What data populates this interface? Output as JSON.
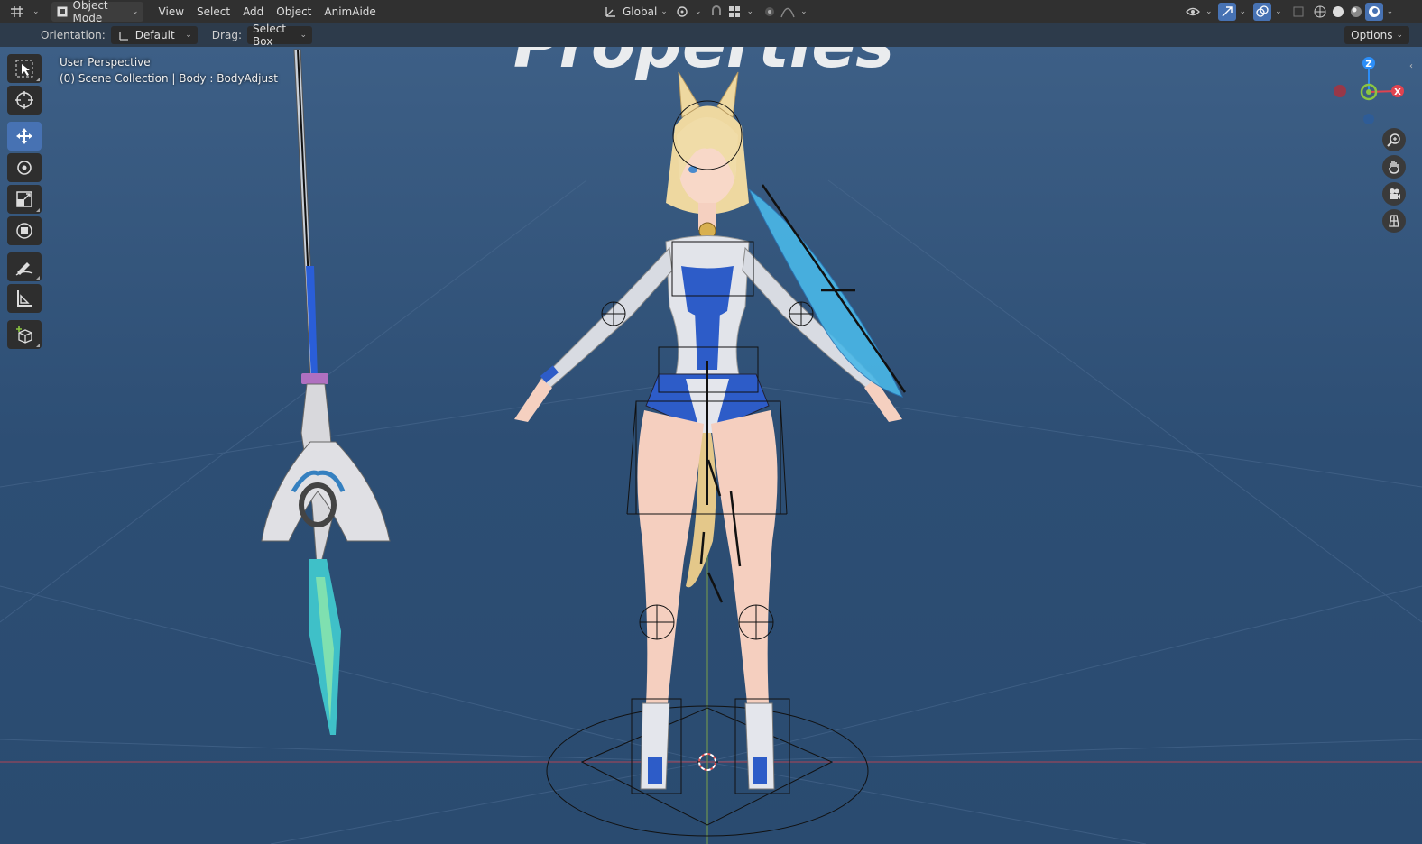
{
  "header": {
    "mode": "Object Mode",
    "menus": [
      "View",
      "Select",
      "Add",
      "Object",
      "AnimAide"
    ],
    "transform_orientation": "Global"
  },
  "tool_settings": {
    "orientation_label": "Orientation:",
    "orientation_value": "Default",
    "drag_label": "Drag:",
    "drag_value": "Select Box",
    "options_label": "Options"
  },
  "viewport": {
    "perspective": "User Perspective",
    "collection": "(0) Scene Collection | Body : BodyAdjust",
    "overlay_text": "Properties"
  },
  "gizmo": {
    "z": "Z",
    "x": "X"
  },
  "colors": {
    "header_bg": "#303030",
    "active_tool": "#4772b3",
    "axis_x": "#e0434f",
    "axis_y": "#8bc540",
    "axis_z": "#2c8ef8"
  },
  "icons": {
    "editor_type": "grid-icon",
    "select": "select-box-icon",
    "cursor": "cursor-icon",
    "move": "move-icon",
    "rotate": "rotate-icon",
    "scale": "scale-icon",
    "transform": "transform-icon",
    "annotate": "annotate-icon",
    "measure": "measure-icon",
    "add_cube": "add-cube-icon",
    "zoom": "zoom-icon",
    "pan": "hand-icon",
    "camera": "camera-icon",
    "ortho": "grid-view-icon"
  }
}
